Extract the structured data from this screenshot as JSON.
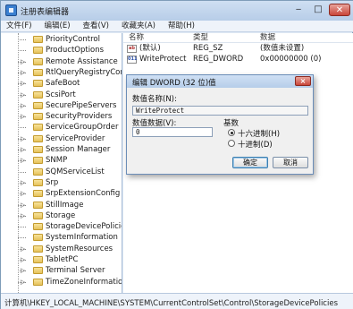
{
  "window": {
    "title": "注册表编辑器"
  },
  "menu": [
    "文件(F)",
    "编辑(E)",
    "查看(V)",
    "收藏夹(A)",
    "帮助(H)"
  ],
  "tree": {
    "items": [
      {
        "label": "PriorityControl",
        "expandable": false
      },
      {
        "label": "ProductOptions",
        "expandable": false
      },
      {
        "label": "Remote Assistance",
        "expandable": true
      },
      {
        "label": "RtlQueryRegistryConf",
        "expandable": true
      },
      {
        "label": "SafeBoot",
        "expandable": true
      },
      {
        "label": "ScsiPort",
        "expandable": true
      },
      {
        "label": "SecurePipeServers",
        "expandable": true
      },
      {
        "label": "SecurityProviders",
        "expandable": true
      },
      {
        "label": "ServiceGroupOrder",
        "expandable": false
      },
      {
        "label": "ServiceProvider",
        "expandable": true
      },
      {
        "label": "Session Manager",
        "expandable": true
      },
      {
        "label": "SNMP",
        "expandable": true
      },
      {
        "label": "SQMServiceList",
        "expandable": false
      },
      {
        "label": "Srp",
        "expandable": true
      },
      {
        "label": "SrpExtensionConfig",
        "expandable": true
      },
      {
        "label": "StillImage",
        "expandable": true
      },
      {
        "label": "Storage",
        "expandable": true
      },
      {
        "label": "StorageDevicePolicies",
        "expandable": false
      },
      {
        "label": "SystemInformation",
        "expandable": false
      },
      {
        "label": "SystemResources",
        "expandable": true
      },
      {
        "label": "TabletPC",
        "expandable": true
      },
      {
        "label": "Terminal Server",
        "expandable": true
      },
      {
        "label": "TimeZoneInformation",
        "expandable": true
      }
    ]
  },
  "list": {
    "headers": {
      "name": "名称",
      "type": "类型",
      "data": "数据"
    },
    "rows": [
      {
        "icon": "string-value-icon",
        "name": "(默认)",
        "type": "REG_SZ",
        "data": "(数值未设置)"
      },
      {
        "icon": "dword-value-icon",
        "name": "WriteProtect",
        "type": "REG_DWORD",
        "data": "0x00000000 (0)"
      }
    ]
  },
  "dialog": {
    "title": "编辑 DWORD (32 位)值",
    "close": "×",
    "name_label": "数值名称(N):",
    "name_value": "WriteProtect",
    "data_label": "数值数据(V):",
    "data_value": "0",
    "base_label": "基数",
    "hex_label": "十六进制(H)",
    "dec_label": "十进制(D)",
    "selected_base": "hex",
    "ok_label": "确定",
    "cancel_label": "取消"
  },
  "status": {
    "path": "计算机\\HKEY_LOCAL_MACHINE\\SYSTEM\\CurrentControlSet\\Control\\StorageDevicePolicies"
  }
}
